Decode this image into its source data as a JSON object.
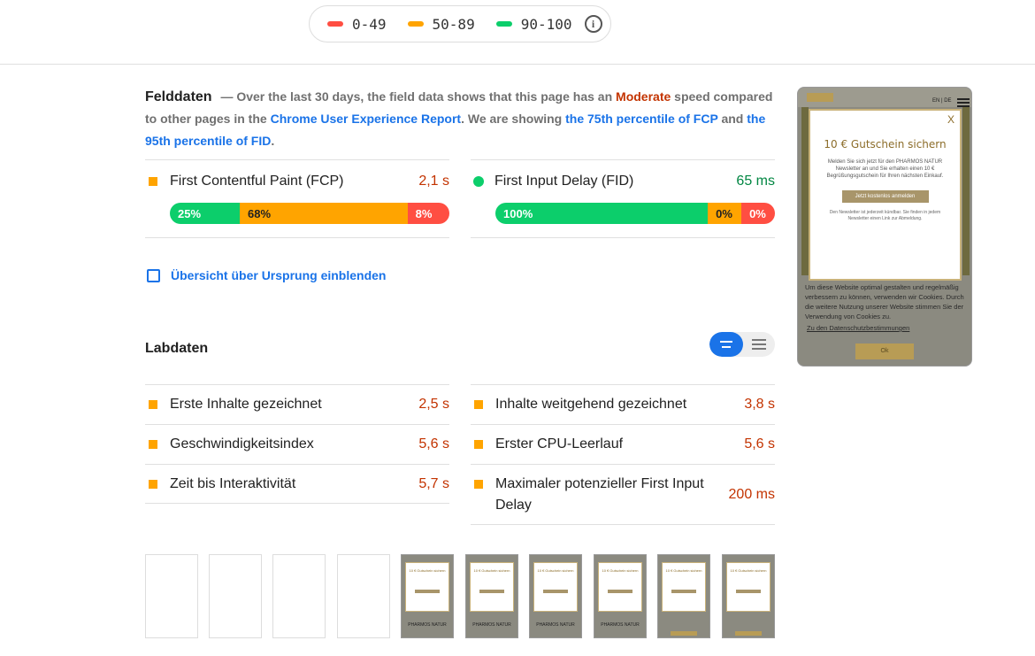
{
  "legend": {
    "items": [
      {
        "label": "0-49",
        "color": "#ff4e42"
      },
      {
        "label": "50-89",
        "color": "#ffa400"
      },
      {
        "label": "90-100",
        "color": "#0cce6b"
      }
    ],
    "info_icon": "info-icon"
  },
  "field": {
    "heading": "Felddaten",
    "intro_1": "— Over the last 30 days, the field data shows that this page has an ",
    "moderate": "Moderate",
    "intro_2": " speed compared to other pages in the ",
    "crux_link": "Chrome User Experience Report",
    "intro_3": ". We are showing ",
    "fcp_link": "the 75th percentile of FCP",
    "intro_4": " and ",
    "fid_link": "the 95th percentile of FID",
    "intro_5": ".",
    "fcp": {
      "name": "First Contentful Paint (FCP)",
      "value": "2,1 s",
      "segments": [
        {
          "label": "25%",
          "percent": 25
        },
        {
          "label": "68%",
          "percent": 60
        },
        {
          "label": "8%",
          "percent": 15
        }
      ]
    },
    "fid": {
      "name": "First Input Delay (FID)",
      "value": "65 ms",
      "segments": [
        {
          "label": "100%",
          "percent": 76
        },
        {
          "label": "0%",
          "percent": 12
        },
        {
          "label": "0%",
          "percent": 12
        }
      ]
    }
  },
  "origin": {
    "label": "Übersicht über Ursprung einblenden"
  },
  "lab": {
    "heading": "Labdaten",
    "left": [
      {
        "name": "Erste Inhalte gezeichnet",
        "value": "2,5 s"
      },
      {
        "name": "Geschwindigkeitsindex",
        "value": "5,6 s"
      },
      {
        "name": "Zeit bis Interaktivität",
        "value": "5,7 s"
      }
    ],
    "right": [
      {
        "name": "Inhalte weitgehend gezeichnet",
        "value": "3,8 s"
      },
      {
        "name": "Erster CPU-Leerlauf",
        "value": "5,6 s"
      },
      {
        "name": "Maximaler potenzieller First Input Delay",
        "value": "200 ms"
      }
    ]
  },
  "screenshot": {
    "lang": "EN | DE",
    "close": "X",
    "popup_title": "10 € Gutschein sichern",
    "popup_text": "Melden Sie sich jetzt für den PHARMOS NATUR Newsletter an und Sie erhalten einen 10 € Begrüßungsgutschein für Ihren nächsten Einkauf.",
    "popup_button": "Jetzt kostenlos anmelden",
    "popup_small": "Den Newsletter ist jederzeit kündbar. Sie finden in jedem Newsletter einen Link zur Abmeldung.",
    "cookie_text": "Um diese Website optimal gestalten und regelmäßig verbessern zu können, verwenden wir Cookies. Durch die weitere Nutzung unserer Website stimmen Sie der Verwendung von Cookies zu.",
    "cookie_link": "Zu den Datenschutzbestimmungen",
    "cookie_button": "Ok"
  },
  "filmstrip": {
    "mini_title": "10 € Gutschein sichern",
    "mini_brand": "PHARMOS NATUR"
  }
}
